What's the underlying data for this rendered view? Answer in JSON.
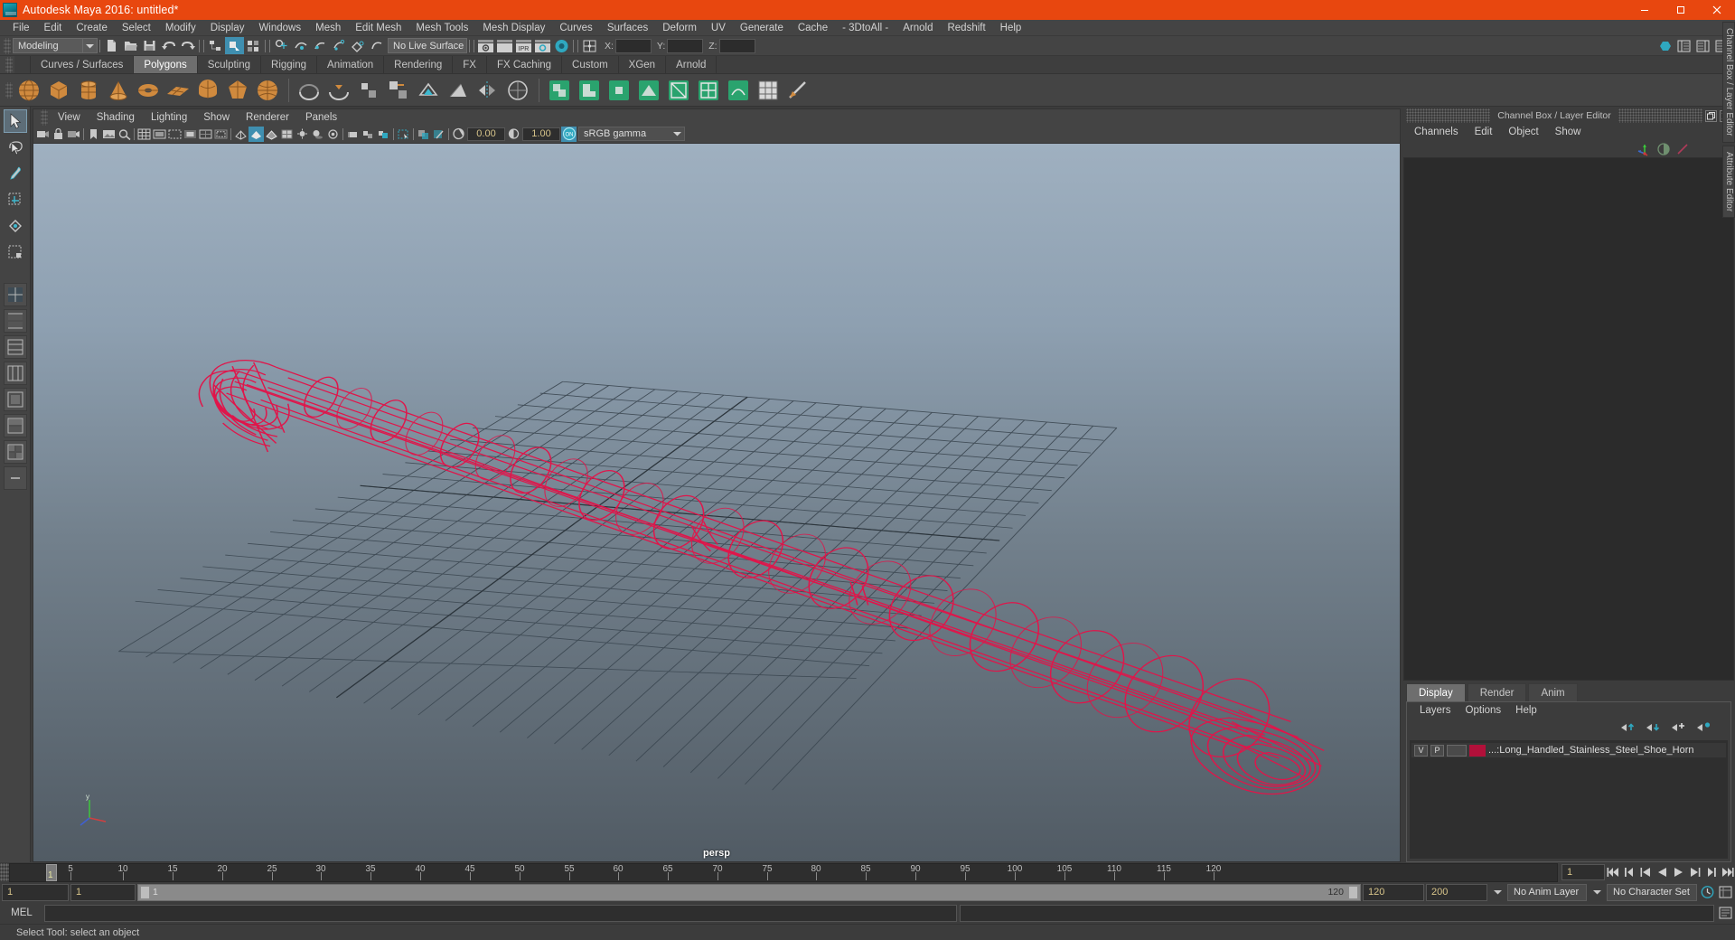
{
  "window": {
    "title": "Autodesk Maya 2016: untitled*",
    "logo_icon": "maya-logo-icon",
    "minimize_icon": "minimize-icon",
    "maximize_icon": "maximize-icon",
    "close_icon": "close-icon"
  },
  "menubar": {
    "items": [
      "File",
      "Edit",
      "Create",
      "Select",
      "Modify",
      "Display",
      "Windows",
      "Mesh",
      "Edit Mesh",
      "Mesh Tools",
      "Mesh Display",
      "Curves",
      "Surfaces",
      "Deform",
      "UV",
      "Generate",
      "Cache",
      "- 3DtoAll -",
      "Arnold",
      "Redshift",
      "Help"
    ]
  },
  "statusline": {
    "menu_set": "Modeling",
    "live_surface": "No Live Surface",
    "coord_x_label": "X:",
    "coord_y_label": "Y:",
    "coord_z_label": "Z:",
    "coord_x_value": "",
    "coord_y_value": "",
    "coord_z_value": ""
  },
  "shelf": {
    "tabs": [
      "Curves / Surfaces",
      "Polygons",
      "Sculpting",
      "Rigging",
      "Animation",
      "Rendering",
      "FX",
      "FX Caching",
      "Custom",
      "XGen",
      "Arnold"
    ],
    "active_tab": "Polygons",
    "icons": [
      "poly-sphere-icon",
      "poly-cube-icon",
      "poly-cylinder-icon",
      "poly-cone-icon",
      "poly-torus-icon",
      "poly-plane-icon",
      "poly-disc-icon",
      "poly-platonic-icon",
      "poly-sphere-smooth-icon",
      "poly-combine-icon",
      "poly-extrude-icon",
      "poly-bevel-icon",
      "poly-bridge-icon",
      "poly-append-icon",
      "poly-wedge-icon",
      "poly-booleans-icon",
      "poly-mirror-icon",
      "poly-smooth-icon",
      "poly-triangulate-icon",
      "poly-quadrangulate-icon",
      "poly-reduce-icon",
      "sculpt-grab-icon",
      "sculpt-smooth-icon",
      "sculpt-relax-icon",
      "sculpt-pinch-icon",
      "sculpt-flatten-icon",
      "sculpt-foamy-icon",
      "sculpt-spray-icon",
      "sculpt-repeat-icon",
      "sculpt-imprint-icon"
    ]
  },
  "toolbox": {
    "items": [
      "select-tool",
      "lasso-select-tool",
      "paint-select-tool",
      "move-tool",
      "rotate-tool",
      "scale-tool",
      "last-tool",
      "quick-layout-four-icon",
      "quick-layout-persp-outliner-icon",
      "quick-layout-persp-graph-icon",
      "quick-layout-persp-hypershade-icon",
      "quick-layout-single-icon",
      "quick-layout-two-stacked-icon",
      "quick-layout-four-panes-icon",
      "quick-layout-more-icon"
    ],
    "selected": "select-tool"
  },
  "viewport": {
    "menus": [
      "View",
      "Shading",
      "Lighting",
      "Show",
      "Renderer",
      "Panels"
    ],
    "camera_label": "persp",
    "exposure": "0.00",
    "gamma": "1.00",
    "color_management_toggle": "ON",
    "color_profile": "sRGB gamma",
    "toolbar_icons": [
      "select-camera-icon",
      "lock-camera-icon",
      "camera-attributes-icon",
      "bookmarks-icon",
      "image-plane-icon",
      "two-d-pan-zoom-icon",
      "grid-toggle-icon",
      "film-gate-icon",
      "resolution-gate-icon",
      "gate-mask-icon",
      "field-chart-icon",
      "safe-action-icon",
      "safe-title-icon",
      "wireframe-icon",
      "smooth-shade-icon",
      "shaded-wireframe-icon",
      "textured-icon",
      "lighting-icon",
      "shadows-icon",
      "screen-space-ao-icon",
      "motion-blur-icon",
      "multisample-icon",
      "depth-of-field-icon",
      "isolate-select-icon",
      "xray-icon",
      "xray-joints-icon",
      "exposure-icon",
      "gamma-icon"
    ],
    "model": {
      "name": "Long Handled Stainless Steel Shoe Horn",
      "display_mode": "wireframe",
      "wireframe_color": "#e0154a"
    },
    "grid": {
      "visible": true,
      "color": "#3c4750"
    },
    "axis_gizmo": {
      "x_color": "#d04040",
      "y_color": "#40c040",
      "z_color": "#4060d0",
      "label": "y"
    }
  },
  "channel_box": {
    "panel_title": "Channel Box / Layer Editor",
    "menus": [
      "Channels",
      "Edit",
      "Object",
      "Show"
    ],
    "undock_icon": "undock-icon",
    "close_icon": "close-panel-icon",
    "header_icons": [
      "show-manipulators-icon",
      "show-channel-box-icon",
      "show-anim-layers-icon"
    ]
  },
  "layer_editor": {
    "tabs": [
      "Display",
      "Render",
      "Anim"
    ],
    "active_tab": "Display",
    "menus": [
      "Layers",
      "Options",
      "Help"
    ],
    "buttons": [
      "move-layer-up-icon",
      "move-layer-down-icon",
      "new-layer-icon",
      "new-layer-from-selected-icon"
    ],
    "layers": [
      {
        "visibility": "V",
        "playback": "P",
        "state": "",
        "color": "#b2103a",
        "name": "...:Long_Handled_Stainless_Steel_Shoe_Horn"
      }
    ]
  },
  "right_sidebar": {
    "tabs": [
      "Channel Box / Layer Editor",
      "Attribute Editor"
    ]
  },
  "timeline": {
    "current_frame": "1",
    "ticks": [
      {
        "label": "5",
        "value": 5
      },
      {
        "label": "10",
        "value": 10
      },
      {
        "label": "15",
        "value": 15
      },
      {
        "label": "20",
        "value": 20
      },
      {
        "label": "25",
        "value": 25
      },
      {
        "label": "30",
        "value": 30
      },
      {
        "label": "35",
        "value": 35
      },
      {
        "label": "40",
        "value": 40
      },
      {
        "label": "45",
        "value": 45
      },
      {
        "label": "50",
        "value": 50
      },
      {
        "label": "55",
        "value": 55
      },
      {
        "label": "60",
        "value": 60
      },
      {
        "label": "65",
        "value": 65
      },
      {
        "label": "70",
        "value": 70
      },
      {
        "label": "75",
        "value": 75
      },
      {
        "label": "80",
        "value": 80
      },
      {
        "label": "85",
        "value": 85
      },
      {
        "label": "90",
        "value": 90
      },
      {
        "label": "95",
        "value": 95
      },
      {
        "label": "100",
        "value": 100
      },
      {
        "label": "105",
        "value": 105
      },
      {
        "label": "110",
        "value": 110
      },
      {
        "label": "115",
        "value": 115
      },
      {
        "label": "120",
        "value": 120
      }
    ],
    "range_min": 1,
    "range_max": 120,
    "frame_field": "1",
    "playback_buttons": [
      "go-to-start-icon",
      "step-back-key-icon",
      "step-back-frame-icon",
      "play-backwards-icon",
      "play-forwards-icon",
      "step-forward-frame-icon",
      "step-forward-key-icon",
      "go-to-end-icon"
    ]
  },
  "range_slider": {
    "start_field": "1",
    "anim_start_field": "1",
    "bar_start_label": "1",
    "bar_end_label": "120",
    "anim_end_field": "120",
    "end_field": "200",
    "anim_layer": "No Anim Layer",
    "character_set": "No Character Set",
    "auto_key_icon": "auto-keyframe-icon",
    "prefs_icon": "animation-preferences-icon"
  },
  "command_line": {
    "label": "MEL",
    "input_value": "",
    "output_value": ""
  },
  "status_bar": {
    "message": "Select Tool: select an object"
  }
}
